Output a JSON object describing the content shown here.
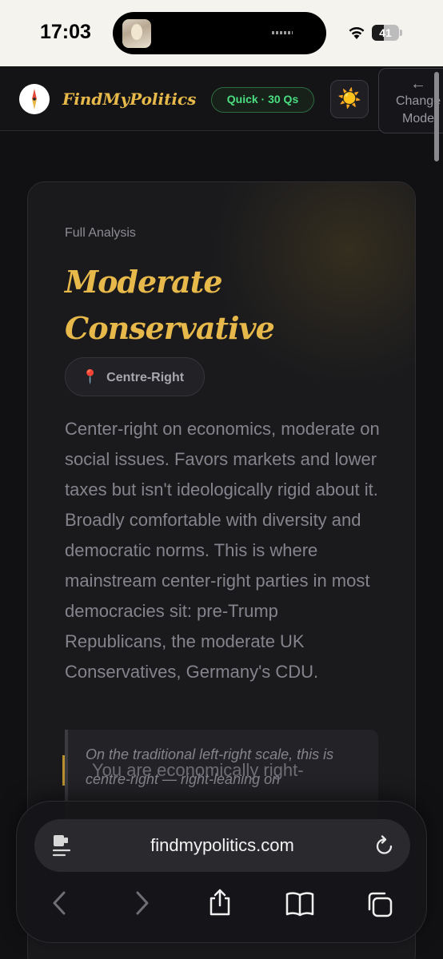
{
  "status_bar": {
    "time": "17:03",
    "battery": "41"
  },
  "header": {
    "brand": "FindMyPolitics",
    "mode_pill": "Quick · 30 Qs",
    "theme_toggle_icon": "☀️",
    "change_mode_arrow": "←",
    "change_mode_label": "Change Mode"
  },
  "result": {
    "eyebrow": "Full Analysis",
    "title": "Moderate Conservative",
    "position_pin": "📍",
    "position": "Centre-Right",
    "description": "Center-right on economics, moderate on social issues. Favors markets and lower taxes but isn't ideologically rigid about it. Broadly comfortable with diversity and democratic norms. This is where mainstream center-right parties in most democracies sit: pre-Trump Republicans, the moderate UK Conservatives, Germany's CDU.",
    "note": "On the traditional left-right scale, this is centre-right — right-leaning on",
    "next_text": "You are economically right-"
  },
  "browser": {
    "url": "findmypolitics.com"
  },
  "colors": {
    "accent_gold": "#e7b84a",
    "mode_green": "#4ade80",
    "background": "#111114"
  },
  "icons": {
    "logo": "compass-logo-icon",
    "theme": "sun-icon",
    "reader": "reader-mode-icon",
    "reload": "reload-icon",
    "back": "back-chevron-icon",
    "forward": "forward-chevron-icon",
    "share": "share-icon",
    "bookmarks": "bookmarks-icon",
    "tabs": "tabs-icon"
  }
}
